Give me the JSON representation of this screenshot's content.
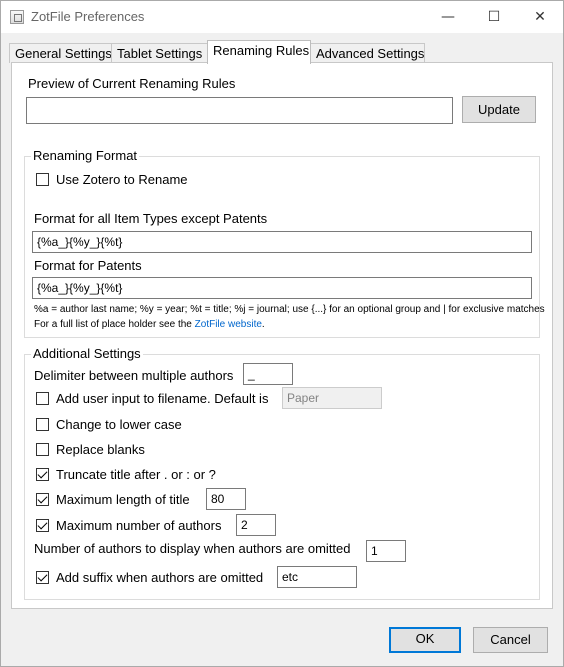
{
  "window": {
    "title": "ZotFile Preferences",
    "minimize_glyph": "—",
    "maximize_glyph": "☐",
    "close_glyph": "✕"
  },
  "tabs": [
    {
      "label": "General Settings",
      "active": false
    },
    {
      "label": "Tablet Settings",
      "active": false
    },
    {
      "label": "Renaming Rules",
      "active": true
    },
    {
      "label": "Advanced Settings",
      "active": false
    }
  ],
  "preview": {
    "heading": "Preview of Current Renaming Rules",
    "value": "",
    "update_label": "Update"
  },
  "renaming_format": {
    "title": "Renaming Format",
    "use_zotero_label": "Use Zotero to Rename",
    "use_zotero_checked": false,
    "format_all_label": "Format for all Item Types except Patents",
    "format_all_value": "{%a_}{%y_}{%t}",
    "format_patents_label": "Format for Patents",
    "format_patents_value": "{%a_}{%y_}{%t}",
    "help_line": "%a = author last name; %y = year; %t = title; %j = journal; use {...} for an optional group and | for exclusive matches",
    "full_list_text": "For a full list of place holder see the",
    "full_list_link": "ZotFile website",
    "full_list_end": "."
  },
  "additional": {
    "title": "Additional Settings",
    "delimiter_label": "Delimiter between multiple authors",
    "delimiter_value": "_",
    "user_input_label": "Add user input to filename. Default is",
    "user_input_checked": false,
    "user_input_placeholder": "Paper",
    "lower_case_label": "Change to lower case",
    "lower_case_checked": false,
    "replace_blanks_label": "Replace blanks",
    "replace_blanks_checked": false,
    "truncate_label": "Truncate title after . or : or ?",
    "truncate_checked": true,
    "max_length_label": "Maximum length of title",
    "max_length_checked": true,
    "max_length_value": "80",
    "max_authors_label": "Maximum number of authors",
    "max_authors_checked": true,
    "max_authors_value": "2",
    "num_display_label": "Number of authors to display when authors are omitted",
    "num_display_value": "1",
    "suffix_label": "Add suffix when authors are omitted",
    "suffix_checked": true,
    "suffix_value": "etc"
  },
  "footer": {
    "ok_label": "OK",
    "cancel_label": "Cancel"
  }
}
